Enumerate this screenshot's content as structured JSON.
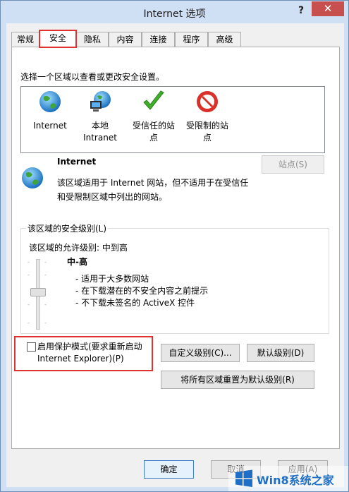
{
  "window": {
    "title": "Internet 选项",
    "help_glyph": "?",
    "close_glyph": "✕"
  },
  "tabs": [
    {
      "label": "常规"
    },
    {
      "label": "安全"
    },
    {
      "label": "隐私"
    },
    {
      "label": "内容"
    },
    {
      "label": "连接"
    },
    {
      "label": "程序"
    },
    {
      "label": "高级"
    }
  ],
  "security": {
    "instruction": "选择一个区域以查看或更改安全设置。",
    "zones": [
      {
        "label": "Internet",
        "icon": "globe-icon"
      },
      {
        "label": "本地\nIntranet",
        "icon": "intranet-icon"
      },
      {
        "label": "受信任的站\n点",
        "icon": "check-icon"
      },
      {
        "label": "受限制的站\n点",
        "icon": "restricted-icon"
      }
    ],
    "selected_zone": {
      "name": "Internet",
      "description": "该区域适用于 Internet 网站，但不适用于在受信任和受限制区域中列出的网站。"
    },
    "sites_button": "站点(S)",
    "level_group": {
      "legend": "该区域的安全级别(L)",
      "allowed": "该区域的允许级别: 中到高",
      "level_name": "中-高",
      "items": [
        "- 适用于大多数网站",
        "- 在下载潜在的不安全内容之前提示",
        "- 不下载未签名的 ActiveX 控件"
      ]
    },
    "protected_mode": {
      "label": "启用保护模式(要求重新启动\nInternet Explorer)(P)",
      "checked": false
    },
    "custom_level_button": "自定义级别(C)...",
    "default_level_button": "默认级别(D)",
    "reset_all_button": "将所有区域重置为默认级别(R)"
  },
  "footer": {
    "ok": "确定",
    "cancel": "取消",
    "apply": "应用(A)"
  },
  "watermark": {
    "text": "Win8系统之家"
  },
  "colors": {
    "highlight": "#e0322f",
    "close": "#c7504f",
    "accent": "#1e6fc5"
  }
}
